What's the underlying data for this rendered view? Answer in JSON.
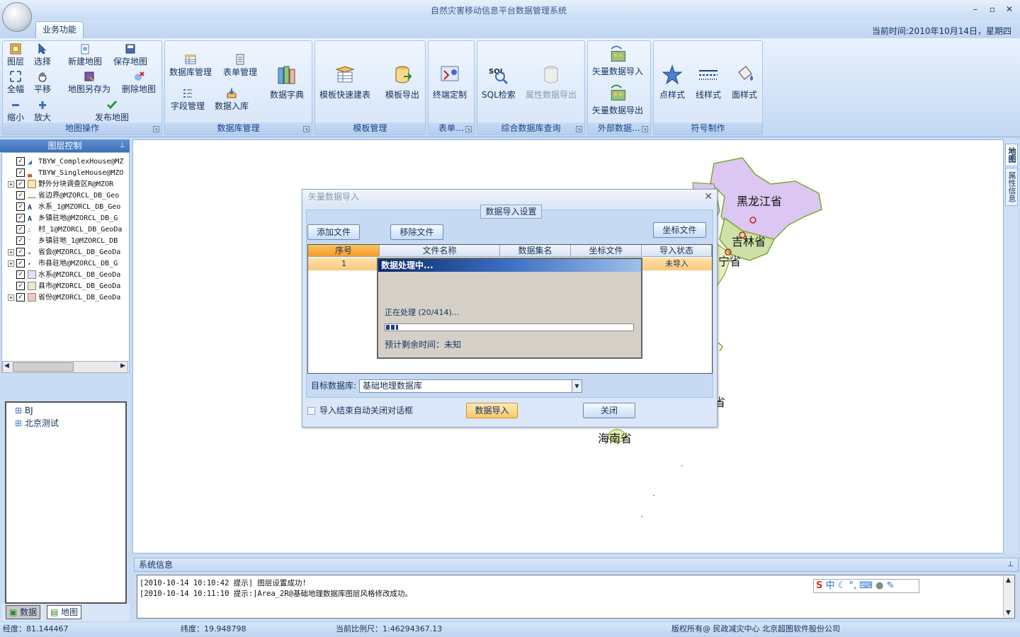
{
  "app": {
    "title": "自然灾害移动信息平台数据管理系统",
    "tab": "业务功能",
    "current_time": "当前时间:2010年10月14日，星期四"
  },
  "window_controls": {
    "minimize": "–",
    "maximize": "▫",
    "close": "✕"
  },
  "ribbon": {
    "groups": [
      "地图操作",
      "数据库管理",
      "模板管理",
      "表单…",
      "综合数据库查询",
      "外部数据…",
      "符号制作"
    ],
    "map_ops": {
      "layer": "图层",
      "select": "选择",
      "new_map": "新建地图",
      "save_map": "保存地图",
      "full": "全幅",
      "pan": "平移",
      "save_as": "地图另存为",
      "delete_map": "删除地图",
      "zoom_out": "缩小",
      "zoom_in": "放大",
      "publish": "发布地图"
    },
    "db_mgmt": {
      "db_manage": "数据库管理",
      "form_manage": "表单管理",
      "field_manage": "字段管理",
      "db_import": "数据入库",
      "dictionary": "数据字典"
    },
    "template": {
      "quick_build": "模板快速建表",
      "export": "模板导出"
    },
    "form": {
      "terminal": "终端定制"
    },
    "query": {
      "sql": "SQL检索",
      "attr_export": "属性数据导出"
    },
    "external": {
      "vector_import": "矢量数据导入",
      "vector_export": "矢量数据导出"
    },
    "symbols": {
      "point": "点样式",
      "line": "线样式",
      "area": "面样式"
    }
  },
  "layers": {
    "header": "图层控制",
    "items": [
      "TBYW_ComplexHouse@MZ",
      "TBYW_SingleHouse@MZO",
      "野外分块调查区R@MZOR",
      "省边界@MZORCL_DB_Geo",
      "水系_1@MZORCL_DB_Geo",
      "乡镇驻地@MZORCL_DB_G",
      "村_1@MZORCL_DB_GeoDa",
      "乡镇驻地_1@MZORCL_DB",
      "省会@MZORCL_DB_GeoDa",
      "市县驻地@MZORCL_DB_G",
      "水系@MZORCL_DB_GeoDa",
      "县市@MZORCL_DB_GeoDa",
      "省份@MZORCL_DB_GeoDa"
    ]
  },
  "datatree": {
    "items": [
      "BJ",
      "北京测试"
    ]
  },
  "bottom_tabs": {
    "data": "数据",
    "map": "地图"
  },
  "right_tabs": {
    "map": "地图",
    "attr": "属性信息"
  },
  "map": {
    "labels": [
      "黑龙江省",
      "吉林省",
      "宁省",
      "省",
      "海南省"
    ]
  },
  "dialog": {
    "title": "矢量数据导入",
    "group": "数据导入设置",
    "add_file": "添加文件",
    "remove_file": "移除文件",
    "coord_file": "坐标文件",
    "columns": [
      "序号",
      "文件名称",
      "数据集名",
      "坐标文件",
      "导入状态"
    ],
    "row": {
      "index": "1",
      "status": "未导入"
    },
    "target_label": "目标数据库:",
    "target_value": "基础地理数据库",
    "auto_close": "导入结束自动关闭对话框",
    "import_btn": "数据导入",
    "close_btn": "关闭"
  },
  "progress": {
    "title": "数据处理中...",
    "text": "正在处理 (20/414)...",
    "remaining": "预计剩余时间：未知",
    "done": 20,
    "total": 414
  },
  "system": {
    "header": "系统信息",
    "logs": [
      "[2010-10-14 10:10:42  提示] 图层设置成功!",
      "[2010-10-14 10:11:10  提示:]Area_2R@基础地理数据库图层风格修改成功。"
    ]
  },
  "ime": {
    "text": "中"
  },
  "statusbar": {
    "lon": "经度：81.144467",
    "lat": "纬度：19.948798",
    "scale": "当前比例尺：1:46294367.13",
    "copyright": "版权所有@ 民政减灾中心 北京超图软件股份公司"
  }
}
